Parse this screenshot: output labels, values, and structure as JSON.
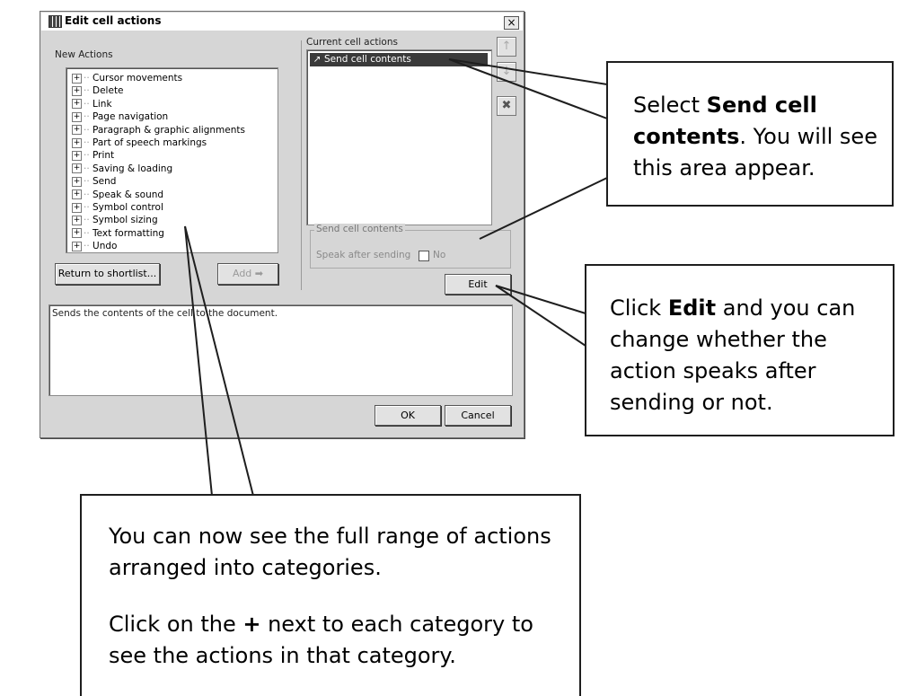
{
  "dialog": {
    "title": "Edit cell actions",
    "close_glyph": "×",
    "new_actions_label": "New Actions",
    "current_actions_label": "Current cell actions",
    "tree_expand_glyph": "+",
    "categories": [
      "Cursor movements",
      "Delete",
      "Link",
      "Page navigation",
      "Paragraph & graphic alignments",
      "Part of speech markings",
      "Print",
      "Saving & loading",
      "Send",
      "Speak & sound",
      "Symbol control",
      "Symbol sizing",
      "Text formatting",
      "Undo"
    ],
    "current_actions": [
      "Send cell contents"
    ],
    "return_button": "Return to shortlist...",
    "add_button": "Add",
    "groupbox_title": "Send cell contents",
    "speak_after_label": "Speak after sending",
    "speak_after_value": "No",
    "edit_button": "Edit",
    "description": "Sends the contents of the cell to the document.",
    "ok_button": "OK",
    "cancel_button": "Cancel",
    "icons": [
      "grid-icon",
      "close-icon",
      "plus-icon",
      "arrow-right-icon",
      "arrow-up-icon",
      "arrow-down-icon",
      "delete-x-icon",
      "send-action-icon"
    ]
  },
  "callouts": {
    "select": {
      "pre": "Select ",
      "bold": "Send cell contents",
      "post": ". You will see this area appear."
    },
    "edit": {
      "pre": "Click ",
      "bold": "Edit",
      "post": " and you can change whether the action speaks after sending or not."
    },
    "categories_line1": "You can now see the full range of actions arranged into categories.",
    "categories_line2_pre": "Click on the ",
    "categories_line2_bold": "+",
    "categories_line2_post": " next to each category to see the actions in that category."
  }
}
